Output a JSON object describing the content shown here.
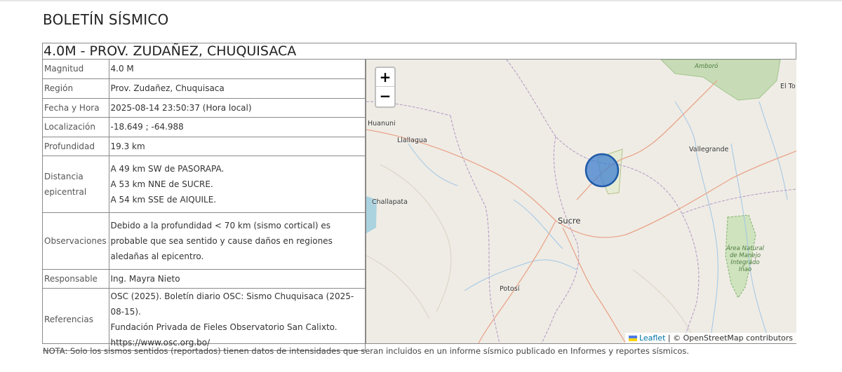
{
  "page": {
    "title": "BOLETÍN SÍSMICO"
  },
  "bulletin": {
    "heading": "4.0M - PROV. ZUDAÑEZ, CHUQUISACA",
    "rows": {
      "magnitude": {
        "label": "Magnitud",
        "value": "4.0 M"
      },
      "region": {
        "label": "Región",
        "value": "Prov. Zudañez, Chuquisaca"
      },
      "datetime": {
        "label": "Fecha y Hora",
        "value": "2025-08-14 23:50:37 (Hora local)"
      },
      "location": {
        "label": "Localización",
        "value": "-18.649 ; -64.988"
      },
      "depth": {
        "label": "Profundidad",
        "value": "19.3 km"
      },
      "distance": {
        "label": "Distancia epicentral",
        "lines": [
          "A 49 km SW de PASORAPA.",
          "A 53 km NNE de SUCRE.",
          "A 54 km SSE de AIQUILE."
        ]
      },
      "observations": {
        "label": "Observaciones",
        "value": "Debido a la profundidad < 70 km (sismo cortical) es probable que sea sentido y cause daños en regiones aledañas al epicentro."
      },
      "responsible": {
        "label": "Responsable",
        "value": "Ing. Mayra Nieto"
      },
      "references": {
        "label": "Referencias",
        "lines": [
          "OSC (2025). Boletín diario OSC: Sismo Chuquisaca (2025-08-15).",
          "Fundación Privada de Fieles Observatorio San Calixto.",
          "https://www.osc.org.bo/"
        ]
      }
    }
  },
  "map": {
    "zoom_in": "+",
    "zoom_out": "−",
    "places": {
      "amboro": "Amboró",
      "eltorno": "El To",
      "huanuni": "Huanuni",
      "llallagua": "Llallagua",
      "vallegrande": "Vallegrande",
      "challapata": "Challapata",
      "sucre": "Sucre",
      "potosi": "Potosí",
      "iniao": "Área Natural de Manejo Integrado Iñao"
    },
    "attribution": {
      "leaflet": "Leaflet",
      "separator": " | © ",
      "osm": "OpenStreetMap contributors"
    },
    "colors": {
      "marker_fill": "#3f7fcf",
      "marker_stroke": "#1e5aa8",
      "park": "#c3dbb2"
    }
  },
  "note": "NOTA: Solo los sismos sentidos (reportados) tienen datos de intensidades que seran incluidos en un informe sísmico publicado en Informes y reportes sísmicos."
}
